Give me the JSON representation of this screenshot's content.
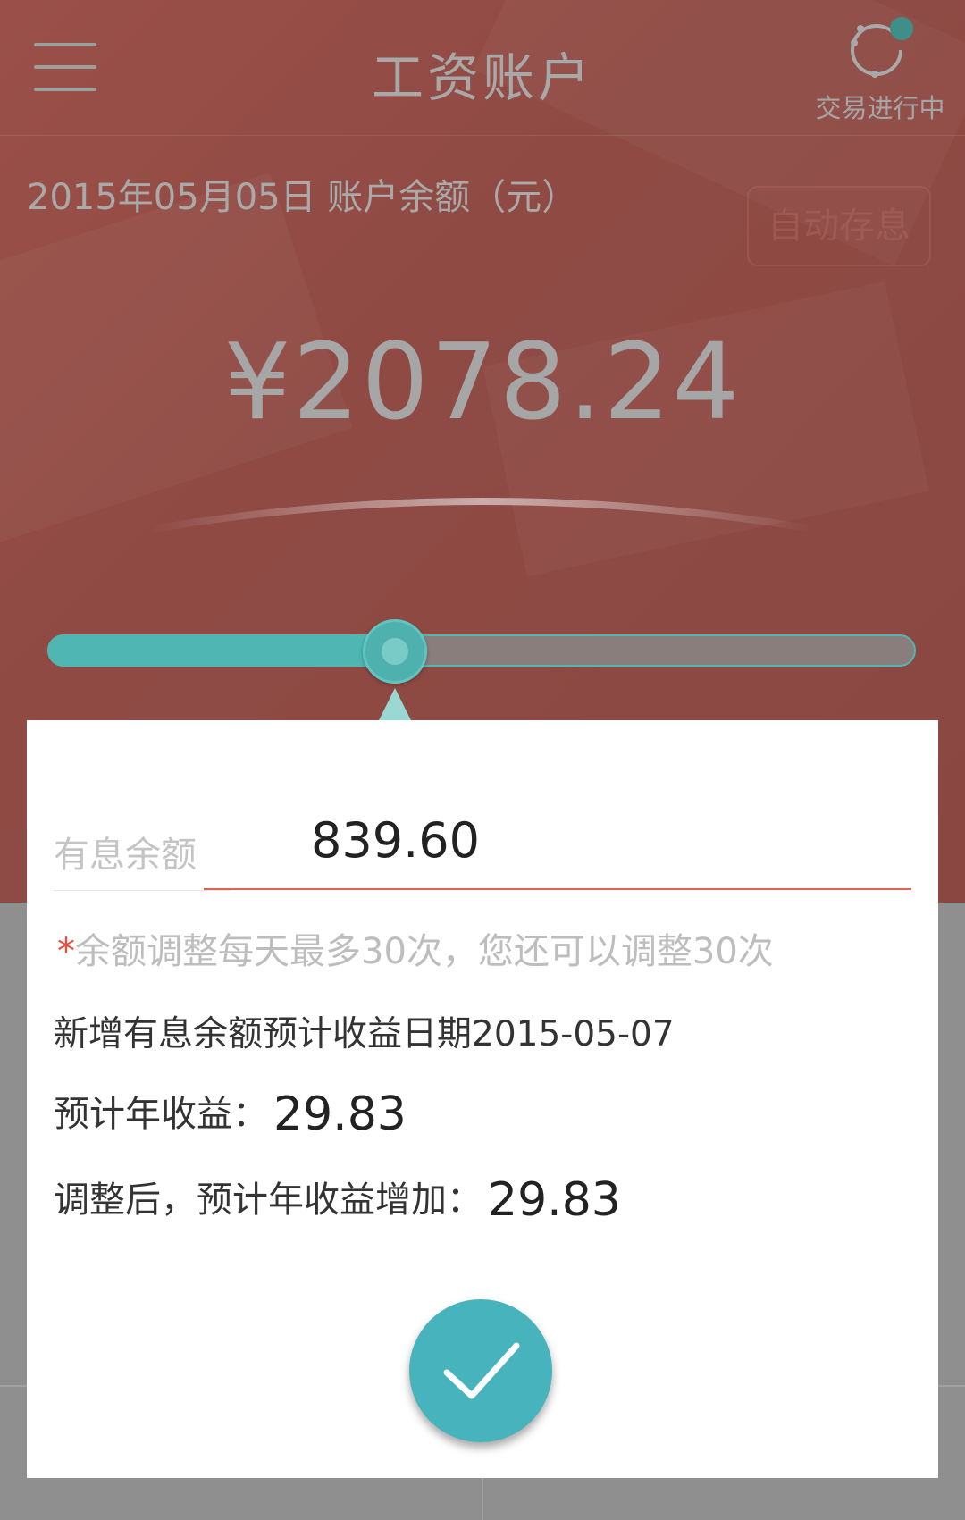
{
  "header": {
    "title": "工资账户",
    "status_label": "交易进行中"
  },
  "account": {
    "date_label": "2015年05月05日 账户余额（元）",
    "auto_button": "自动存息",
    "balance": "¥2078.24"
  },
  "slider": {
    "fraction": 0.4
  },
  "dialog": {
    "field_label": "有息余额",
    "field_value": "839.60",
    "notice_star": "*",
    "notice": "余额调整每天最多30次，您还可以调整30次",
    "info_date": "新增有息余额预计收益日期2015-05-07",
    "annual_label": "预计年收益：",
    "annual_value": "29.83",
    "increase_label": "调整后，预计年收益增加：",
    "increase_value": "29.83"
  },
  "colors": {
    "accent": "#4fb6b3",
    "header_bg": "#8f4a44",
    "underline": "#e0644e",
    "confirm": "#46b3bd"
  },
  "icons": {
    "menu": "menu-icon",
    "status": "sync-status-icon",
    "confirm": "check-icon"
  }
}
